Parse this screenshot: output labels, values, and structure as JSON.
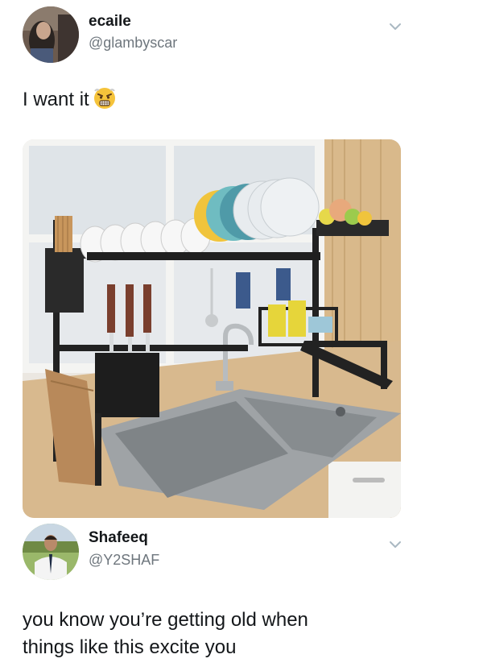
{
  "tweets": [
    {
      "name": "ecaile",
      "handle": "@glambyscar",
      "text": "I want it",
      "emoji": "angry-face-emoji"
    },
    {
      "name": "Shafeeq",
      "handle": "@Y2SHAF",
      "text_line1": "you know you’re getting old when",
      "text_line2": "things like this excite you"
    }
  ],
  "colors": {
    "name": "#14171a",
    "handle": "#6e767d",
    "chevron": "#aab8c2"
  }
}
